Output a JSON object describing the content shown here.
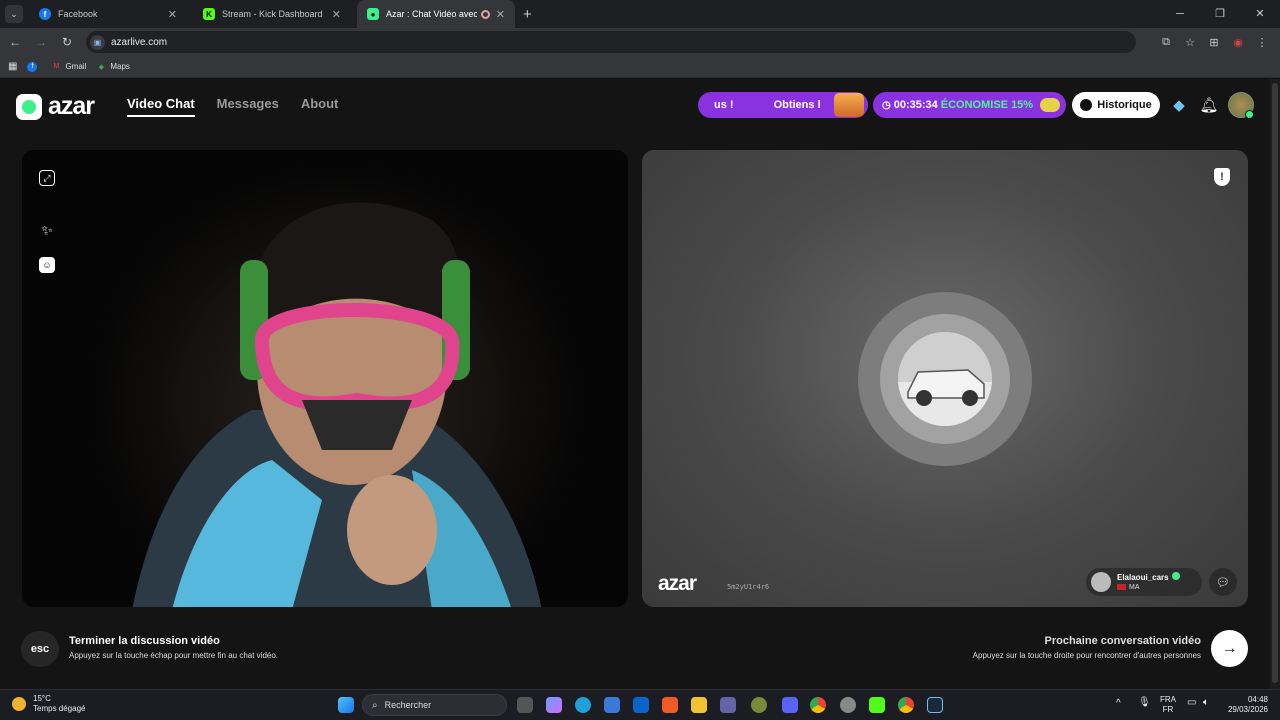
{
  "browser": {
    "tabs": [
      {
        "title": "Facebook",
        "icon": "facebook-icon",
        "color": "#1877f2",
        "glyph": "f"
      },
      {
        "title": "Stream - Kick Dashboard",
        "icon": "kick-icon",
        "color": "#53fc18",
        "glyph": "K"
      },
      {
        "title": "Azar : Chat Vidéo avec de n",
        "icon": "azar-icon",
        "color": "#3df08a",
        "glyph": "●"
      }
    ],
    "new_tab": "+",
    "url": "azarlive.com",
    "bookmarks": [
      {
        "label": "",
        "icon": "facebook-icon",
        "color": "#1877f2",
        "glyph": "f"
      },
      {
        "label": "Gmail",
        "icon": "gmail-icon",
        "color": "#ea4335",
        "glyph": "M"
      },
      {
        "label": "Maps",
        "icon": "maps-icon",
        "color": "#34a853",
        "glyph": "◆"
      }
    ]
  },
  "site": {
    "logo": "azar",
    "nav": [
      "Video Chat",
      "Messages",
      "About"
    ],
    "promo_left_a": "us !",
    "promo_left_b": "Obtiens l",
    "timer": "00:35:34",
    "discount": "ÉCONOMISE 15%",
    "history_button": "Historique"
  },
  "partner": {
    "watermark": "azar",
    "watermark_code": "5m2yU1r4r6",
    "username": "Elalaoui_cars",
    "country": "MA"
  },
  "footer": {
    "esc_key": "esc",
    "end_title": "Terminer la discussion vidéo",
    "end_subtitle": "Appuyez sur la touche échap pour mettre fin au chat vidéo.",
    "next_title": "Prochaine conversation vidéo",
    "next_subtitle": "Appuyez sur la touche droite pour rencontrer d'autres personnes"
  },
  "taskbar": {
    "temperature": "15°C",
    "weather": "Temps dégagé",
    "search_placeholder": "Rechercher",
    "lang_top": "FRA",
    "lang_bottom": "FR",
    "time": "04:48",
    "date": "29/03/2026"
  },
  "colors": {
    "accent_green": "#3df08a",
    "promo_purple": "#8a32e0",
    "page_bg": "#141414"
  }
}
